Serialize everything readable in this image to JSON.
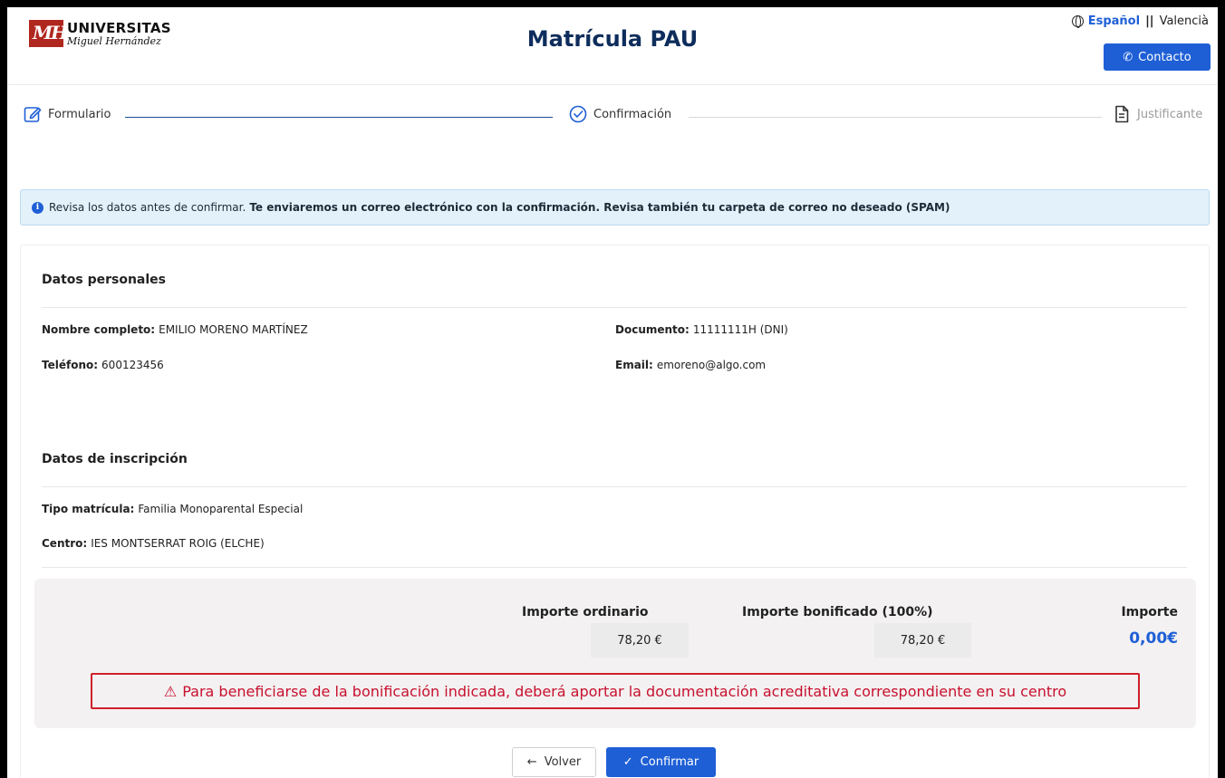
{
  "header": {
    "logo_title": "UNIVERSITAS",
    "logo_subtitle": "Miguel Hernández",
    "page_title": "Matrícula PAU",
    "language_active": "Español",
    "language_separator": "||",
    "language_other": "Valencià",
    "contact_label": "Contacto"
  },
  "stepper": {
    "steps": [
      {
        "label": "Formulario",
        "state": "completed"
      },
      {
        "label": "Confirmación",
        "state": "active"
      },
      {
        "label": "Justificante",
        "state": "pending"
      }
    ]
  },
  "alert": {
    "text": "Revisa los datos antes de confirmar.",
    "bold_text": "Te enviaremos un correo electrónico con la confirmación. Revisa también tu carpeta de correo no deseado (SPAM)"
  },
  "personal": {
    "title": "Datos personales",
    "name_label": "Nombre completo:",
    "name_value": "EMILIO MORENO MARTÍNEZ",
    "doc_label": "Documento:",
    "doc_value": "11111111H (DNI)",
    "phone_label": "Teléfono:",
    "phone_value": "600123456",
    "email_label": "Email:",
    "email_value": "emoreno@algo.com"
  },
  "inscription": {
    "title": "Datos de inscripción",
    "type_label": "Tipo matrícula:",
    "type_value": "Familia Monoparental Especial",
    "center_label": "Centro:",
    "center_value": "IES MONTSERRAT ROIG (ELCHE)"
  },
  "amounts": {
    "ordinary_label": "Importe ordinario",
    "ordinary_value": "78,20 €",
    "bonus_label": "Importe bonificado (100%)",
    "bonus_value": "78,20 €",
    "total_label": "Importe",
    "total_value": "0,00€",
    "warning": "Para beneficiarse de la bonificación indicada, deberá aportar la documentación acreditativa correspondiente en su centro"
  },
  "actions": {
    "back_label": "Volver",
    "confirm_label": "Confirmar"
  },
  "colors": {
    "primary": "#1e5fd6",
    "title": "#0e2d5c",
    "warning": "#d0202b",
    "alert_bg": "#e3f1fb"
  }
}
